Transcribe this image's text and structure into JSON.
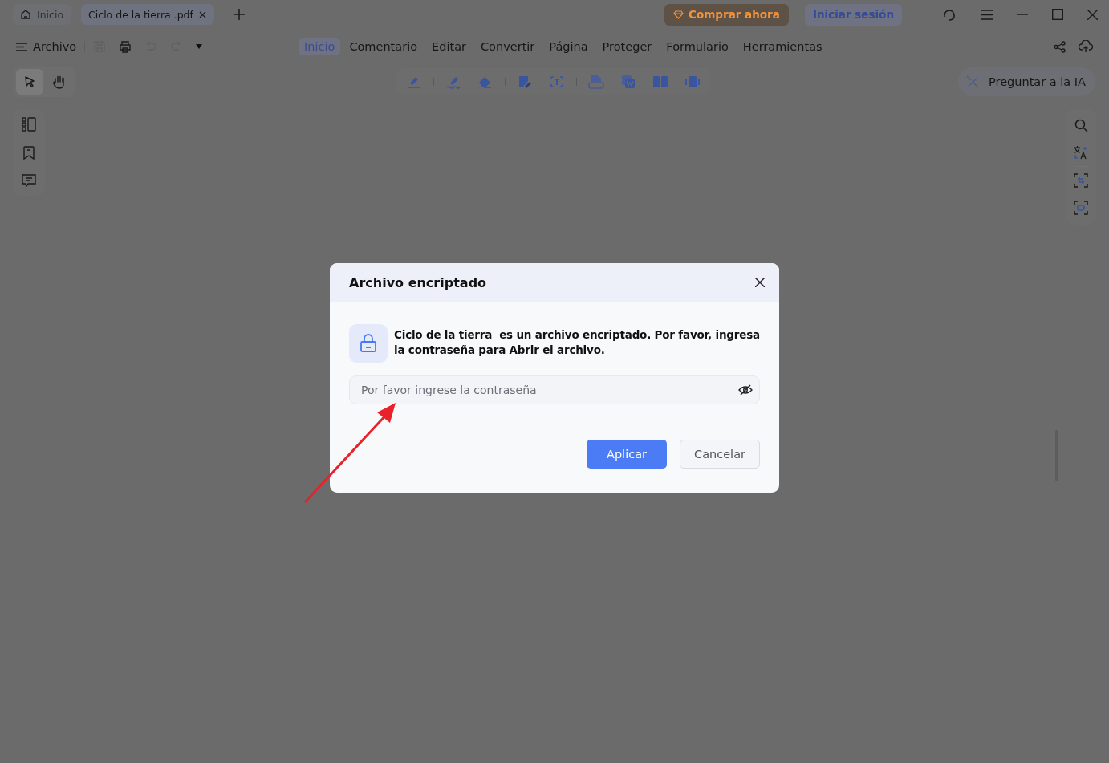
{
  "tabs": [
    {
      "label": "Inicio",
      "kind": "home",
      "selected": false
    },
    {
      "label": "Ciclo de la tierra .pdf",
      "kind": "document",
      "selected": true
    }
  ],
  "buy_button": "Comprar ahora",
  "login_button": "Iniciar sesión",
  "file_menu": "Archivo",
  "quick_tools": [
    {
      "kind": "save",
      "disabled": true
    },
    {
      "kind": "print",
      "disabled": false
    },
    {
      "kind": "undo",
      "disabled": true
    },
    {
      "kind": "redo",
      "disabled": true
    }
  ],
  "ribbon_tabs": [
    {
      "label": "Inicio",
      "selected": true
    },
    {
      "label": "Comentario",
      "selected": false
    },
    {
      "label": "Editar",
      "selected": false
    },
    {
      "label": "Convertir",
      "selected": false
    },
    {
      "label": "Página",
      "selected": false
    },
    {
      "label": "Proteger",
      "selected": false
    },
    {
      "label": "Formulario",
      "selected": false
    },
    {
      "label": "Herramientas",
      "selected": false
    }
  ],
  "pointer_tools": [
    {
      "kind": "select",
      "selected": true
    },
    {
      "kind": "hand",
      "selected": false
    }
  ],
  "ai_button": "Preguntar a la IA",
  "dialog": {
    "title": "Archivo encriptado",
    "message": "Ciclo de la tierra  es un archivo encriptado. Por favor, ingresa la contraseña para Abrir el archivo.",
    "password_field": {
      "placeholder": "Por favor ingrese la contraseña"
    },
    "buttons": [
      {
        "label": "Aplicar",
        "kind": "primary"
      },
      {
        "label": "Cancelar",
        "kind": "secondary"
      }
    ]
  }
}
